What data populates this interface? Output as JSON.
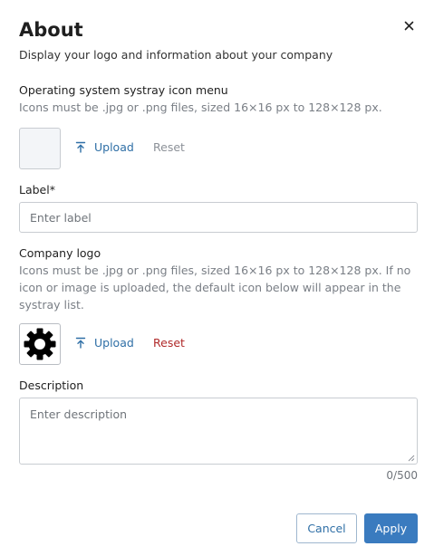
{
  "dialog": {
    "title": "About",
    "subtitle": "Display your logo and information about your company"
  },
  "systray": {
    "title": "Operating system systray icon menu",
    "hint": "Icons must be .jpg or .png files, sized 16×16 px to 128×128 px.",
    "upload_label": "Upload",
    "reset_label": "Reset",
    "reset_enabled": false
  },
  "label_field": {
    "label": "Label*",
    "placeholder": "Enter label",
    "value": ""
  },
  "company_logo": {
    "title": "Company logo",
    "hint": "Icons must be .jpg or .png files, sized 16×16 px to 128×128 px. If no icon or image is uploaded, the default icon below will appear in the systray list.",
    "upload_label": "Upload",
    "reset_label": "Reset",
    "reset_enabled": true,
    "icon": "gear-icon"
  },
  "description_field": {
    "label": "Description",
    "placeholder": "Enter description",
    "value": "",
    "counter": "0/500"
  },
  "footer": {
    "cancel_label": "Cancel",
    "apply_label": "Apply"
  },
  "colors": {
    "accent": "#3a7bbf",
    "link": "#2f6fa6",
    "danger": "#b02a2a",
    "muted": "#7a7f86"
  }
}
